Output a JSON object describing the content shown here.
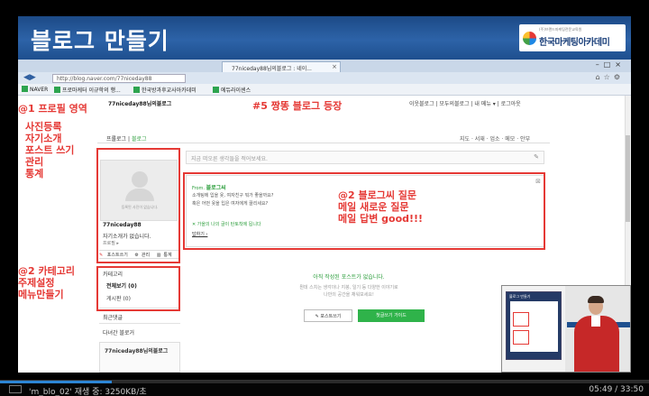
{
  "banner": {
    "title": "블로그 만들기",
    "logo_sub": "(주)브랜드마케팅전문교육원",
    "logo_text": "한국마케팅아카데미"
  },
  "browser": {
    "address": "http://blog.naver.com/77niceday88",
    "tab_title": "77niceday88님의블로그 : 네이...",
    "favorites": [
      "NAVER",
      "프로마케터 이규학의 행...",
      "한국방과후교사아카데미",
      "에듀라이센스"
    ]
  },
  "blog": {
    "name": "77niceday88님의블로그",
    "top_links": "이웃블로그 | 모두의블로그 | 내 메뉴 ▾ | 로그아웃",
    "breadcrumb_prologue": "프롤로그",
    "breadcrumb_blog": "블로그",
    "menu_links": "지도 · 서재 · 업소 · 메모 · 안부",
    "compose_placeholder": "지금 떠오른 생각들을 적어보세요.",
    "profile": {
      "photo_caption": "등록된 사진이 없습니다.",
      "name": "77niceday88",
      "intro": "자기소개가 없습니다.",
      "edit": "프로필 ▸",
      "action_write": "포스트쓰기",
      "action_manage": "관리",
      "action_stats": "통계"
    },
    "category": {
      "title": "카테고리",
      "item_all": "전체보기 (0)",
      "item_board": "게시판 (0)"
    },
    "sidebar_recent_comments": "최근댓글",
    "sidebar_neighbor": "다녀간 블로거",
    "sidebar_box_title": "77niceday88님의블로그",
    "notice": {
      "from_label": "From.",
      "from_name": "블로그씨",
      "line1": "소개팅에 입을 옷, 여자친구 뭐가 좋을까요?",
      "line2": "혹은 어떤 옷을 입은 여자에게 끌리세요?",
      "link": "가을의 나의 글이 탄토착에 됩니다",
      "more": "답하기 ›"
    },
    "empty": {
      "title": "아직 작성된 포스트가 없습니다.",
      "sub1": "뭔데 스치는 생각이나 지붕, 일기 등 다양한 이야기로",
      "sub2": "나만의 공간을 채워보세요!"
    },
    "btn_write": "✎ 포스트쓰기",
    "btn_guide": "첫글쓰기 가이드"
  },
  "annotations": {
    "profile_area": [
      "@1 프로필 영역",
      "사진등록",
      "자기소개",
      "포스트 쓰기",
      "관리",
      "통계"
    ],
    "category": [
      "@2 카테고리",
      "주제설정",
      "메뉴만들기"
    ],
    "blog_title": "#5 짱똥 블로그 등장",
    "blogc": [
      "@2 블로그씨 질문",
      "메일 새로운 질문",
      "메일 답변 good!!!"
    ]
  },
  "webcam": {
    "screen_title": "블로그 만들기"
  },
  "player": {
    "status": "'m_blo_02' 재생 중: 3250KB/초",
    "time": "05:49 / 33:50",
    "progress": 0.172
  },
  "colors": {
    "banner": "#2d63a8",
    "annotation": "#e53935",
    "naver_green": "#2fb34a",
    "progress": "#2d86d6"
  }
}
